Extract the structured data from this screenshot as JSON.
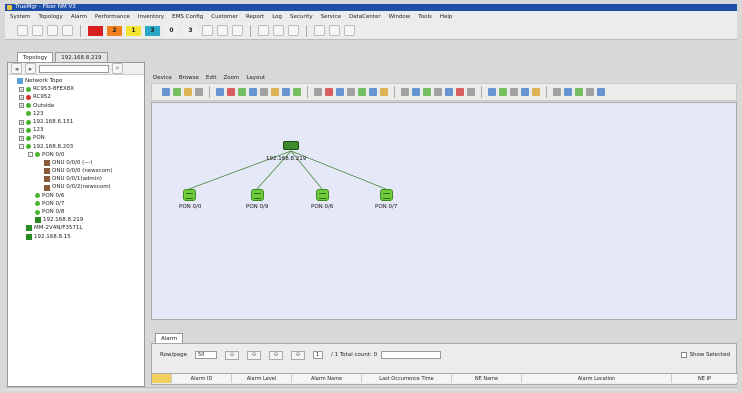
{
  "window": {
    "title": "TrueMgr - Fiber NM V3"
  },
  "menu": [
    "System",
    "Topology",
    "Alarm",
    "Performance",
    "Inventory",
    "EMS Config",
    "Customer",
    "Report",
    "Log",
    "Security",
    "Service",
    "DataCenter",
    "Window",
    "Tools",
    "Help"
  ],
  "severity": [
    {
      "label": "",
      "color": "#d82020"
    },
    {
      "label": "2",
      "color": "#f08020"
    },
    {
      "label": "1",
      "color": "#f2e430"
    },
    {
      "label": "3",
      "color": "#2aa8c8"
    },
    {
      "label": "0",
      "color": "#f0f0f0"
    },
    {
      "label": "3",
      "color": "#f0f0f0"
    }
  ],
  "tabs": [
    "Topology",
    "192.168.8.219"
  ],
  "tree": [
    {
      "label": "Network Topo",
      "indent": 0,
      "color": "#5aa0d8",
      "shape": "sq",
      "exp": ""
    },
    {
      "label": "RC953-8FEX8X",
      "indent": 1,
      "color": "#4cb030",
      "shape": "dot",
      "exp": "+"
    },
    {
      "label": "RC952",
      "indent": 1,
      "color": "#d03030",
      "shape": "dot",
      "exp": "+"
    },
    {
      "label": "Outside",
      "indent": 1,
      "color": "#4cb030",
      "shape": "dot",
      "exp": "+"
    },
    {
      "label": "123",
      "indent": 1,
      "color": "#4cb030",
      "shape": "dot",
      "exp": ""
    },
    {
      "label": "192.168.6.151",
      "indent": 1,
      "color": "#4cb030",
      "shape": "dot",
      "exp": "+"
    },
    {
      "label": "123",
      "indent": 1,
      "color": "#4cb030",
      "shape": "dot",
      "exp": "+"
    },
    {
      "label": "PON",
      "indent": 1,
      "color": "#4cb030",
      "shape": "dot",
      "exp": "+"
    },
    {
      "label": "192.168.8.203",
      "indent": 1,
      "color": "#4cb030",
      "shape": "dot",
      "exp": "-"
    },
    {
      "label": "PON 0/0",
      "indent": 2,
      "color": "#4cb030",
      "shape": "dot",
      "exp": "-"
    },
    {
      "label": "ONU 0/0/0 (---)",
      "indent": 3,
      "color": "#8a5a3a",
      "shape": "sq",
      "exp": ""
    },
    {
      "label": "ONU 0/0/0 (newscom)",
      "indent": 3,
      "color": "#8a5a3a",
      "shape": "sq",
      "exp": ""
    },
    {
      "label": "ONU 0/0/1(admin)",
      "indent": 3,
      "color": "#8a5a3a",
      "shape": "sq",
      "exp": ""
    },
    {
      "label": "ONU 0/0/2(newscom)",
      "indent": 3,
      "color": "#8a5a3a",
      "shape": "sq",
      "exp": ""
    },
    {
      "label": "PON 0/6",
      "indent": 2,
      "color": "#4cb030",
      "shape": "dot",
      "exp": ""
    },
    {
      "label": "PON 0/7",
      "indent": 2,
      "color": "#4cb030",
      "shape": "dot",
      "exp": ""
    },
    {
      "label": "PON 0/8",
      "indent": 2,
      "color": "#4cb030",
      "shape": "dot",
      "exp": ""
    },
    {
      "label": "192.168.8.219",
      "indent": 2,
      "color": "#2a8a20",
      "shape": "sq",
      "exp": ""
    },
    {
      "label": "MM-2V4N/F3571L",
      "indent": 1,
      "color": "#2a8a20",
      "shape": "sq",
      "exp": ""
    },
    {
      "label": "192.168.8.15",
      "indent": 1,
      "color": "#2a8a20",
      "shape": "sq",
      "exp": ""
    }
  ],
  "right_menu": [
    "Device",
    "Browse",
    "Edit",
    "Zoom",
    "Layout"
  ],
  "topology": {
    "root": {
      "label": "192.168.8.219"
    },
    "children": [
      {
        "label": "PON 0/0"
      },
      {
        "label": "PON 0/9"
      },
      {
        "label": "PON 0/6"
      },
      {
        "label": "PON 0/7"
      }
    ]
  },
  "alarm": {
    "tab_label": "Alarm",
    "per_page_label": "Row/page",
    "per_page_value": "50",
    "page_value": "1",
    "total_label": "/ 1 Total count: 0",
    "show_selected": "Show Selected",
    "columns": [
      "",
      "Alarm ID",
      "Alarm Level",
      "Alarm Name",
      "Last Occurrence Time",
      "NE Name",
      "Alarm Location",
      "NE IP"
    ]
  }
}
